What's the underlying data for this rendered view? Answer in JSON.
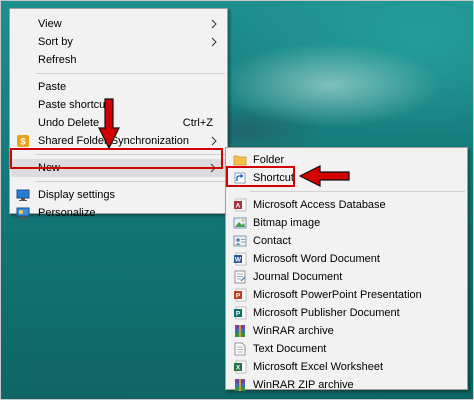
{
  "context_menu": {
    "items": [
      {
        "label": "View",
        "submenu": true
      },
      {
        "label": "Sort by",
        "submenu": true
      },
      {
        "label": "Refresh"
      },
      {
        "label": "Paste"
      },
      {
        "label": "Paste shortcut"
      },
      {
        "label": "Undo Delete",
        "shortcut": "Ctrl+Z"
      },
      {
        "label": "Shared Folder Synchronization",
        "submenu": true
      },
      {
        "label": "New",
        "submenu": true,
        "highlighted": true
      },
      {
        "label": "Display settings"
      },
      {
        "label": "Personalize"
      }
    ]
  },
  "new_submenu": {
    "items": [
      {
        "label": "Folder",
        "icon": "folder-icon"
      },
      {
        "label": "Shortcut",
        "icon": "shortcut-icon",
        "highlighted": true
      },
      {
        "label": "Microsoft Access Database",
        "icon": "access-icon"
      },
      {
        "label": "Bitmap image",
        "icon": "bitmap-icon"
      },
      {
        "label": "Contact",
        "icon": "contact-icon"
      },
      {
        "label": "Microsoft Word Document",
        "icon": "word-icon"
      },
      {
        "label": "Journal Document",
        "icon": "journal-icon"
      },
      {
        "label": "Microsoft PowerPoint Presentation",
        "icon": "powerpoint-icon"
      },
      {
        "label": "Microsoft Publisher Document",
        "icon": "publisher-icon"
      },
      {
        "label": "WinRAR archive",
        "icon": "winrar-icon"
      },
      {
        "label": "Text Document",
        "icon": "text-document-icon"
      },
      {
        "label": "Microsoft Excel Worksheet",
        "icon": "excel-icon"
      },
      {
        "label": "WinRAR ZIP archive",
        "icon": "winrar-zip-icon"
      }
    ]
  },
  "colors": {
    "annotation_red": "#d20000",
    "menu_bg": "#f2f2f2",
    "highlight": "#dcdcdc"
  }
}
